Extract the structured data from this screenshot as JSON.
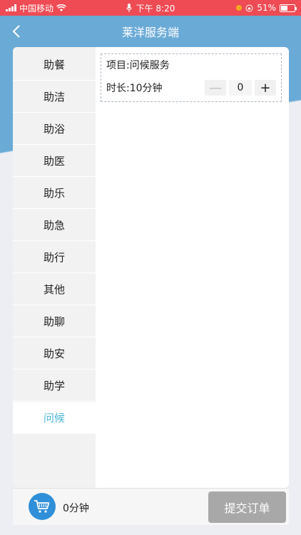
{
  "status_bar": {
    "carrier": "中国移动",
    "time": "下午 8:20",
    "battery": "51%"
  },
  "nav": {
    "title": "莱洋服务端"
  },
  "sidebar": {
    "items": [
      {
        "label": "助餐"
      },
      {
        "label": "助洁"
      },
      {
        "label": "助浴"
      },
      {
        "label": "助医"
      },
      {
        "label": "助乐"
      },
      {
        "label": "助急"
      },
      {
        "label": "助行"
      },
      {
        "label": "其他"
      },
      {
        "label": "助聊"
      },
      {
        "label": "助安"
      },
      {
        "label": "助学"
      },
      {
        "label": "问候"
      }
    ],
    "active_index": 11
  },
  "service": {
    "project_label": "项目:问候服务",
    "duration_label": "时长:10分钟",
    "quantity": "0",
    "minus": "—",
    "plus": "+"
  },
  "footer": {
    "total": "0分钟",
    "submit_label": "提交订单"
  },
  "colors": {
    "status_bar": "#ee4b54",
    "header": "#6aaad6",
    "active_item": "#4fb7d6",
    "cart": "#2f8fd8",
    "submit_disabled": "#a8a8a8"
  }
}
